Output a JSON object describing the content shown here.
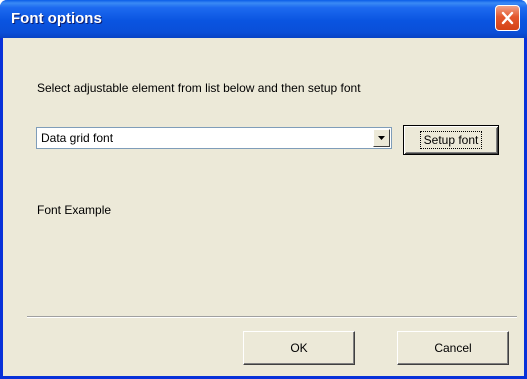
{
  "window": {
    "title": "Font options",
    "close_icon": "close-icon"
  },
  "dialog": {
    "instruction": "Select adjustable element from list below and then setup font",
    "combo": {
      "selected": "Data grid font",
      "arrow_icon": "chevron-down-icon"
    },
    "setup_button": "Setup font",
    "font_example": "Font Example"
  },
  "buttons": {
    "ok": "OK",
    "cancel": "Cancel"
  },
  "colors": {
    "titlebar": "#0a54e0",
    "window_face": "#ece9d8",
    "close_button": "#e4582e"
  }
}
